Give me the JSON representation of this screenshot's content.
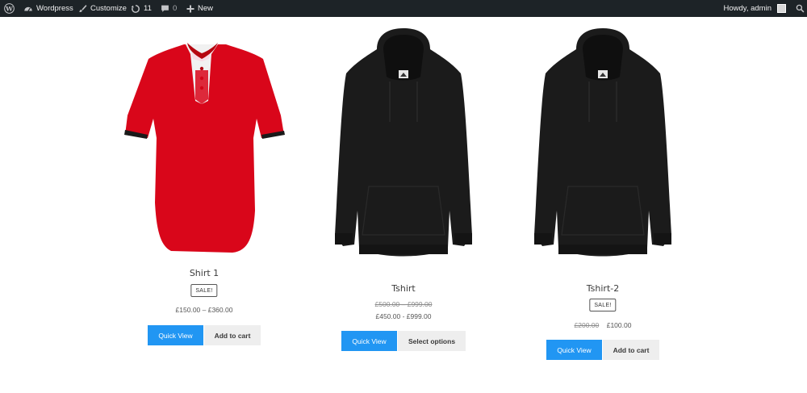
{
  "adminbar": {
    "site_name": "Wordpress",
    "customize": "Customize",
    "updates_count": "11",
    "comments_count": "0",
    "new_label": "New",
    "howdy": "Howdy, admin"
  },
  "products": [
    {
      "title": "Shirt 1",
      "badge": "SALE!",
      "price_range": "£150.00 – £360.00",
      "quick_view": "Quick View",
      "action": "Add to cart",
      "image": "red-polo-shirt"
    },
    {
      "title": "Tshirt",
      "regular_price": "£500.00 – £999.00",
      "sale_price": "£450.00 - £999.00",
      "quick_view": "Quick View",
      "action": "Select options",
      "image": "black-hoodie"
    },
    {
      "title": "Tshirt-2",
      "badge": "SALE!",
      "regular_price": "£200.00",
      "sale_price": "£100.00",
      "quick_view": "Quick View",
      "action": "Add to cart",
      "image": "black-hoodie"
    }
  ],
  "colors": {
    "adminbar_bg": "#1d2327",
    "quick_view_bg": "#2196f3",
    "secondary_button_bg": "#eeeeee",
    "shirt_red": "#d9061a",
    "hoodie_black": "#1b1b1b"
  }
}
